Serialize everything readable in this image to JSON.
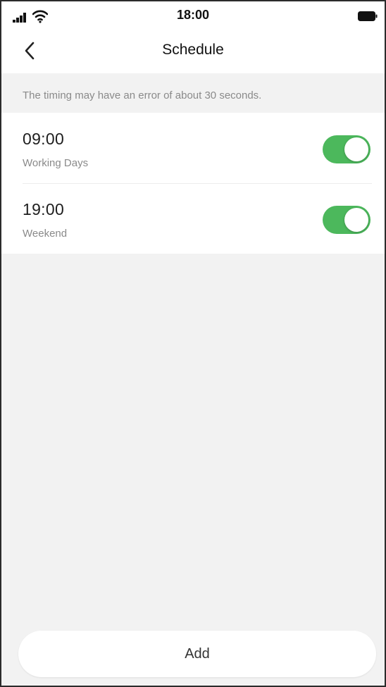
{
  "status_bar": {
    "time": "18:00",
    "icons": [
      "signal-icon",
      "wifi-icon",
      "battery-icon"
    ]
  },
  "nav": {
    "title": "Schedule",
    "back_icon": "chevron-left-icon"
  },
  "info": {
    "text": "The timing may have an error of about 30 seconds."
  },
  "schedules": [
    {
      "time": "09:00",
      "label": "Working Days",
      "enabled": true
    },
    {
      "time": "19:00",
      "label": "Weekend",
      "enabled": true
    }
  ],
  "actions": {
    "add_label": "Add"
  },
  "colors": {
    "toggle_on": "#4cb85c",
    "background": "#f2f2f2",
    "surface": "#ffffff"
  }
}
